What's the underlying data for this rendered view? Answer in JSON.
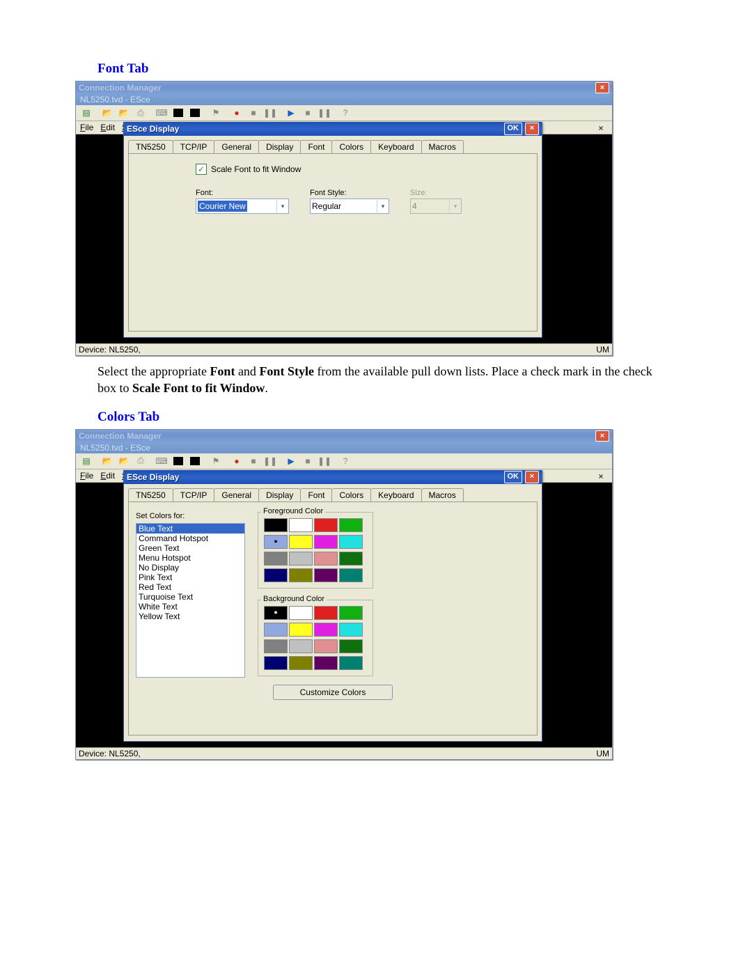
{
  "headings": {
    "font_tab": "Font Tab",
    "colors_tab": "Colors Tab"
  },
  "paragraph": {
    "part1": "Select the appropriate ",
    "bold1": "Font",
    "part2": " and ",
    "bold2": "Font Style",
    "part3": " from the available pull down lists.  Place a check mark in the check box to ",
    "bold3": "Scale Font to fit Window",
    "part4": "."
  },
  "outer": {
    "title": "Connection Manager",
    "subtitle": "NL5250.tvd - ESce"
  },
  "menubar": {
    "file": "File",
    "edit": "Edit",
    "s": "S"
  },
  "statusbar": {
    "left": "Device: NL5250,",
    "right": "UM"
  },
  "dialog": {
    "title": "ESce Display",
    "ok": "OK",
    "tabs": {
      "tn5250": "TN5250",
      "tcpip": "TCP/IP",
      "general": "General",
      "display": "Display",
      "font": "Font",
      "colors": "Colors",
      "keyboard": "Keyboard",
      "macros": "Macros"
    }
  },
  "font_tab": {
    "scale_checkbox_label": "Scale Font to fit Window",
    "scale_checked": true,
    "font_label": "Font:",
    "font_value": "Courier New",
    "style_label": "Font Style:",
    "style_value": "Regular",
    "size_label": "Size:",
    "size_value": "4"
  },
  "colors_tab": {
    "set_colors_label": "Set Colors for:",
    "items": [
      "Blue Text",
      "Command Hotspot",
      "Green Text",
      "Menu Hotspot",
      "No Display",
      "Pink Text",
      "Red Text",
      "Turquoise Text",
      "White Text",
      "Yellow Text"
    ],
    "selected_item_index": 0,
    "foreground_label": "Foreground Color",
    "background_label": "Background Color",
    "foreground_swatches": [
      "#000000",
      "#ffffff",
      "#e02020",
      "#10b010",
      "#90a8e0",
      "#ffff20",
      "#e020e0",
      "#20e0e0",
      "#808080",
      "#c0c0c0",
      "#e09090",
      "#107010",
      "#000070",
      "#808000",
      "#600060",
      "#008070"
    ],
    "foreground_selected_index": 4,
    "background_swatches": [
      "#000000",
      "#ffffff",
      "#e02020",
      "#10b010",
      "#90a8e0",
      "#ffff20",
      "#e020e0",
      "#20e0e0",
      "#808080",
      "#c0c0c0",
      "#e09090",
      "#107010",
      "#000070",
      "#808000",
      "#600060",
      "#008070"
    ],
    "background_selected_index": 0,
    "customize_button": "Customize Colors"
  }
}
